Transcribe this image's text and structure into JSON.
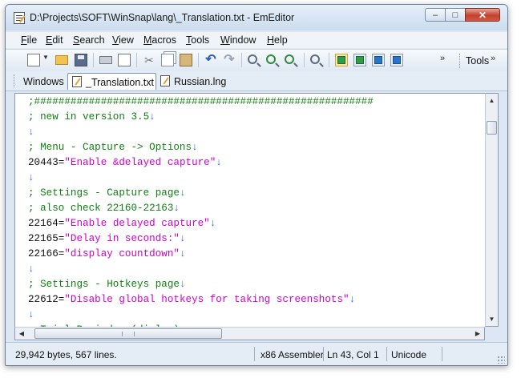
{
  "window": {
    "title": "D:\\Projects\\SOFT\\WinSnap\\lang\\_Translation.txt - EmEditor"
  },
  "menu": [
    "File",
    "Edit",
    "Search",
    "View",
    "Macros",
    "Tools",
    "Window",
    "Help"
  ],
  "menu_accel": [
    "F",
    "E",
    "S",
    "V",
    "M",
    "T",
    "W",
    "H"
  ],
  "toolbar": {
    "tools_label": "Tools",
    "overflow_glyph": "»"
  },
  "tabs": {
    "windows_label": "Windows",
    "items": [
      {
        "label": "_Translation.txt",
        "active": true
      },
      {
        "label": "Russian.lng",
        "active": false
      }
    ]
  },
  "editor": {
    "lines": [
      {
        "parts": [
          {
            "t": ";########################################################",
            "c": "comment"
          }
        ]
      },
      {
        "parts": [
          {
            "t": "; new in version 3.5",
            "c": "comment"
          },
          {
            "t": "↓",
            "c": "mark"
          }
        ]
      },
      {
        "parts": [
          {
            "t": "↓",
            "c": "mark"
          }
        ]
      },
      {
        "parts": [
          {
            "t": "; Menu - Capture -> Options",
            "c": "comment"
          },
          {
            "t": "↓",
            "c": "mark"
          }
        ]
      },
      {
        "parts": [
          {
            "t": "20443=",
            "c": "num"
          },
          {
            "t": "\"Enable &delayed capture\"",
            "c": "str"
          },
          {
            "t": "↓",
            "c": "mark"
          }
        ]
      },
      {
        "parts": [
          {
            "t": "↓",
            "c": "mark"
          }
        ]
      },
      {
        "parts": [
          {
            "t": "; Settings - Capture page",
            "c": "comment"
          },
          {
            "t": "↓",
            "c": "mark"
          }
        ]
      },
      {
        "parts": [
          {
            "t": "; also check 22160-22163",
            "c": "comment"
          },
          {
            "t": "↓",
            "c": "mark"
          }
        ]
      },
      {
        "parts": [
          {
            "t": "22164=",
            "c": "num"
          },
          {
            "t": "\"Enable delayed capture\"",
            "c": "str"
          },
          {
            "t": "↓",
            "c": "mark"
          }
        ]
      },
      {
        "parts": [
          {
            "t": "22165=",
            "c": "num"
          },
          {
            "t": "\"Delay in seconds:\"",
            "c": "str"
          },
          {
            "t": "↓",
            "c": "mark"
          }
        ]
      },
      {
        "parts": [
          {
            "t": "22166=",
            "c": "num"
          },
          {
            "t": "\"display countdown\"",
            "c": "str"
          },
          {
            "t": "↓",
            "c": "mark"
          }
        ]
      },
      {
        "parts": [
          {
            "t": "↓",
            "c": "mark"
          }
        ]
      },
      {
        "parts": [
          {
            "t": "; Settings - Hotkeys page",
            "c": "comment"
          },
          {
            "t": "↓",
            "c": "mark"
          }
        ]
      },
      {
        "parts": [
          {
            "t": "22612=",
            "c": "num"
          },
          {
            "t": "\"Disable global hotkeys for taking screenshots\"",
            "c": "str"
          },
          {
            "t": "↓",
            "c": "mark"
          }
        ]
      },
      {
        "parts": [
          {
            "t": "↓",
            "c": "mark"
          }
        ]
      },
      {
        "parts": [
          {
            "t": "; Trial Reminder (dialog)",
            "c": "comment"
          },
          {
            "t": "↓",
            "c": "mark"
          }
        ]
      }
    ]
  },
  "scrollbar": {
    "vertical_position": 0.08,
    "horizontal_position": 0.0
  },
  "status": {
    "file_info": "29,942 bytes, 567 lines.",
    "syntax": "x86 Assembler",
    "position": "Ln 43, Col 1",
    "encoding": "Unicode"
  },
  "colors": {
    "comment": "#108010",
    "string": "#d000d0",
    "marker": "#2a5ff0",
    "text": "#111111"
  }
}
